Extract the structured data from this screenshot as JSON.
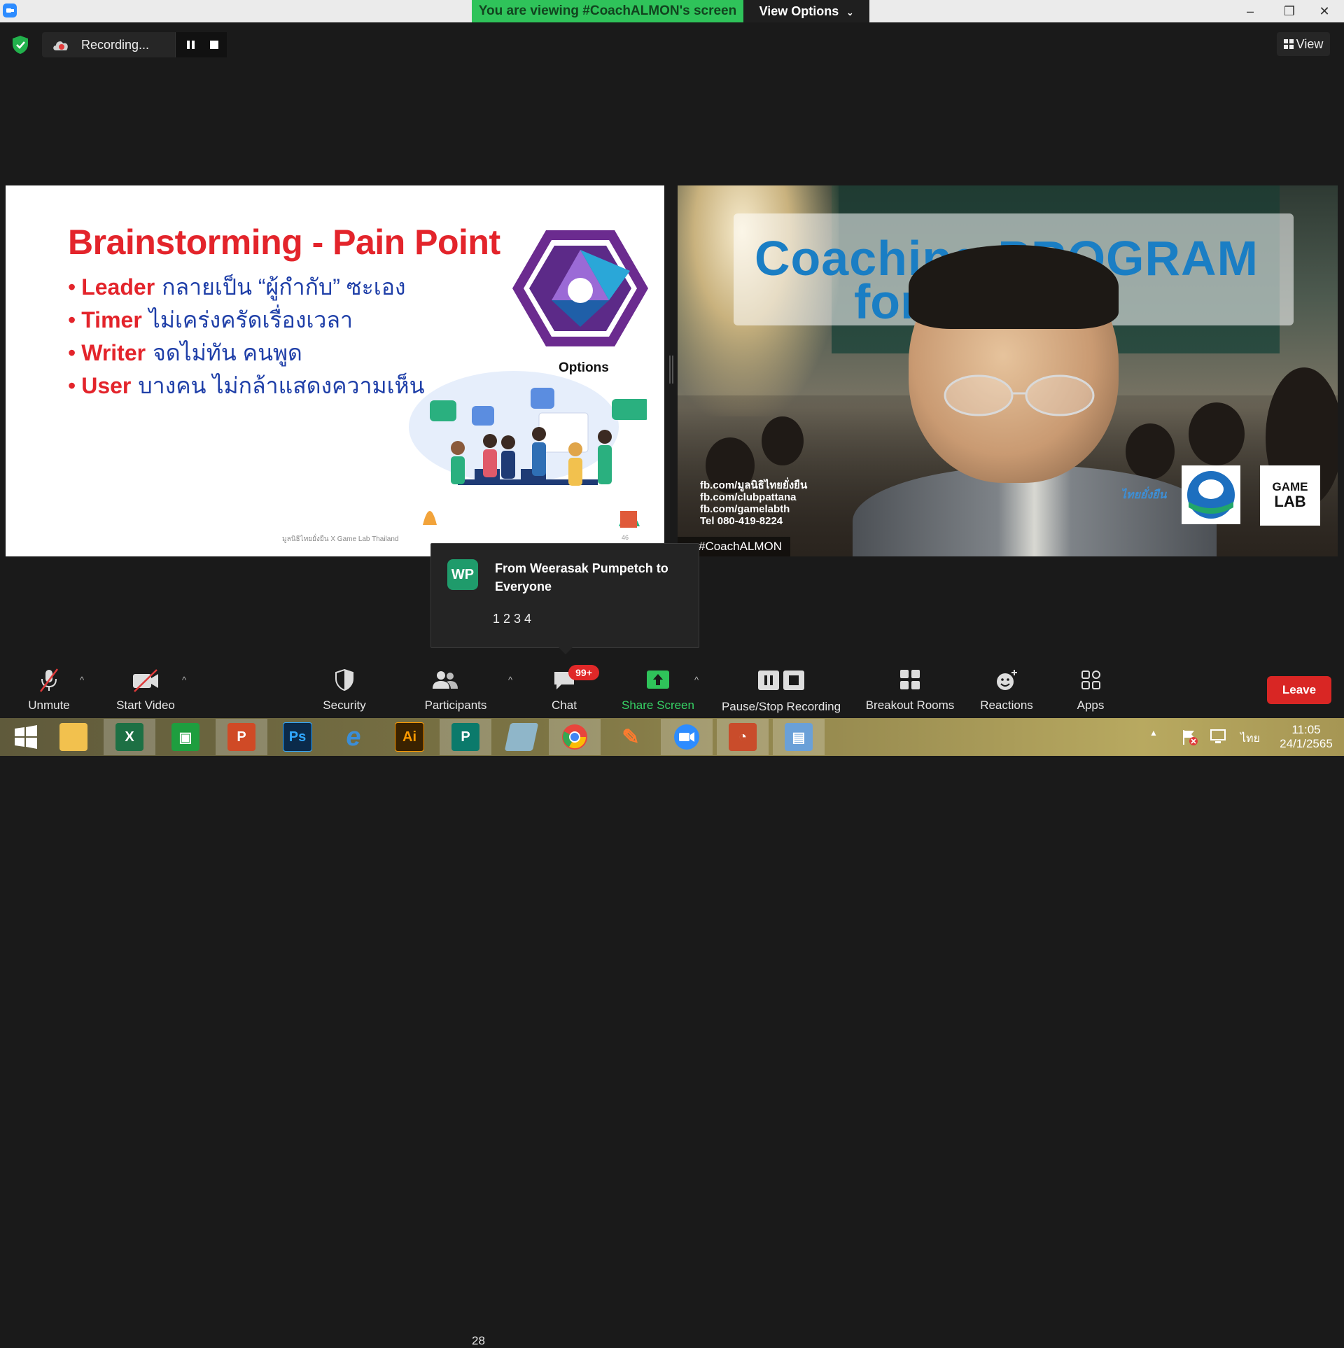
{
  "titlebar": {
    "viewing_banner": "You are viewing #CoachALMON's screen",
    "view_options": "View Options",
    "minimize": "–",
    "restore": "❐",
    "close": "✕"
  },
  "status": {
    "recording_label": "Recording...",
    "view_label": "View"
  },
  "slide": {
    "title": "Brainstorming - Pain Point",
    "bullets": [
      {
        "keyword": "Leader",
        "text": "กลายเป็น “ผู้กำกับ” ซะเอง"
      },
      {
        "keyword": "Timer",
        "text": "ไม่เคร่งครัดเรื่องเวลา"
      },
      {
        "keyword": "Writer",
        "text": "จดไม่ทัน คนพูด"
      },
      {
        "keyword": "User",
        "text": "บางคน ไม่กล้าแสดงความเห็น"
      }
    ],
    "options_label": "Options",
    "footer": "มูลนิธิไทยยั่งยืน X Game Lab Thailand",
    "page_number": "46"
  },
  "video": {
    "program_line1": "Coaching PROGRAM",
    "program_line2": "for       rer",
    "contacts": [
      "fb.com/มูลนิธิไทยยั่งยืน",
      "fb.com/clubpattana",
      "fb.com/gamelabth",
      "Tel 080-419-8224"
    ],
    "logo_thai": "ไทยยั่งยืน",
    "logo_gamelab_1": "GAME",
    "logo_gamelab_2": "LAB",
    "name_tag": "#CoachALMON"
  },
  "chat_toast": {
    "avatar": "WP",
    "from": "From Weerasak Pumpetch to Everyone",
    "message": "1 2 3 4"
  },
  "toolbar": {
    "unmute": "Unmute",
    "start_video": "Start Video",
    "security": "Security",
    "participants": "Participants",
    "participants_count": "28",
    "chat": "Chat",
    "chat_badge": "99+",
    "share_screen": "Share Screen",
    "pause_stop": "Pause/Stop Recording",
    "breakout": "Breakout Rooms",
    "reactions": "Reactions",
    "apps": "Apps",
    "leave": "Leave",
    "caret": "^"
  },
  "taskbar": {
    "apps": [
      {
        "name": "start",
        "glyph": "",
        "color": "#ffffff"
      },
      {
        "name": "file-explorer",
        "glyph": "",
        "color": "#f2c14e"
      },
      {
        "name": "excel",
        "glyph": "X",
        "color": "#1d7044"
      },
      {
        "name": "store",
        "glyph": "",
        "color": "#1e9e3f"
      },
      {
        "name": "powerpoint",
        "glyph": "P",
        "color": "#d04a26"
      },
      {
        "name": "photoshop",
        "glyph": "Ps",
        "color": "#0b2a4a"
      },
      {
        "name": "internet-explorer",
        "glyph": "e",
        "color": "#3b8ed8"
      },
      {
        "name": "illustrator",
        "glyph": "Ai",
        "color": "#3a2200"
      },
      {
        "name": "publisher",
        "glyph": "P",
        "color": "#0b7a6b"
      },
      {
        "name": "notepad",
        "glyph": "",
        "color": "#8fb6c9"
      },
      {
        "name": "chrome",
        "glyph": "",
        "color": "#e8453c"
      },
      {
        "name": "paint",
        "glyph": "",
        "color": "#ff7b2e"
      },
      {
        "name": "zoom",
        "glyph": "",
        "color": "#2d8cff"
      },
      {
        "name": "presentation",
        "glyph": "",
        "color": "#c94c2b"
      },
      {
        "name": "remote-desktop",
        "glyph": "",
        "color": "#6aa0d8"
      }
    ],
    "tray_arrow": "▲",
    "lang": "ไทย",
    "time": "11:05",
    "date": "24/1/2565"
  },
  "colors": {
    "banner_green": "#2fc35a",
    "slide_red": "#e3242b",
    "slide_blue": "#1f3fa8",
    "share_green": "#36d165",
    "leave_red": "#d92624",
    "badge_red": "#e02828"
  }
}
